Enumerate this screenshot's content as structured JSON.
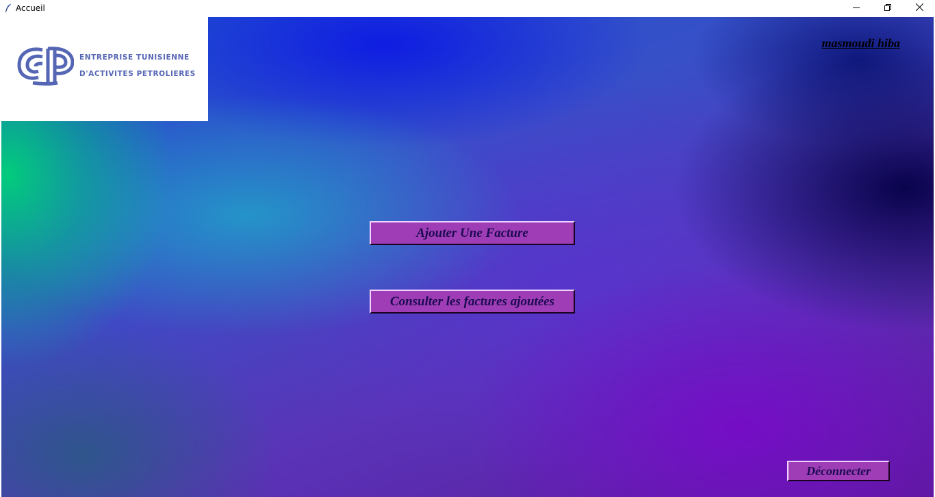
{
  "window": {
    "title": "Accueil",
    "app_icon": "feather-icon",
    "controls": {
      "minimize": "minimize-icon",
      "maximize": "restore-icon",
      "close": "close-icon"
    }
  },
  "logo": {
    "line1": "ENTREPRISE TUNISIENNE",
    "line2": "D'ACTIVITES PETROLIERES",
    "color": "#5566b4"
  },
  "user": {
    "name": "masmoudi hiba"
  },
  "actions": {
    "add_invoice_label": "Ajouter Une Facture",
    "consult_invoices_label": "Consulter les factures ajoutées",
    "logout_label": "Déconnecter"
  },
  "colors": {
    "button_bg": "#9e3db5",
    "button_text": "#1c0a52"
  }
}
